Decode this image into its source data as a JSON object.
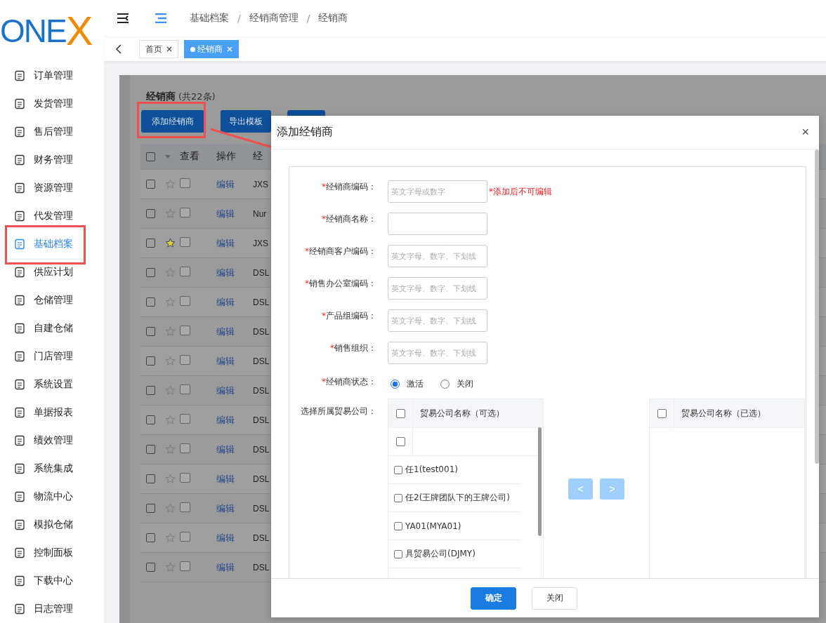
{
  "logo": {
    "text": "ONEX"
  },
  "breadcrumb": {
    "separator": "/",
    "items": [
      "基础档案",
      "经销商管理",
      "经销商"
    ]
  },
  "tabs": [
    {
      "label": "首页",
      "selected": false
    },
    {
      "label": "经销商",
      "selected": true
    }
  ],
  "sidebar": {
    "items": [
      {
        "label": "订单管理",
        "selected": false
      },
      {
        "label": "发货管理",
        "selected": false
      },
      {
        "label": "售后管理",
        "selected": false
      },
      {
        "label": "财务管理",
        "selected": false
      },
      {
        "label": "资源管理",
        "selected": false
      },
      {
        "label": "代发管理",
        "selected": false
      },
      {
        "label": "基础档案",
        "selected": true
      },
      {
        "label": "供应计划",
        "selected": false
      },
      {
        "label": "仓储管理",
        "selected": false
      },
      {
        "label": "自建仓储",
        "selected": false
      },
      {
        "label": "门店管理",
        "selected": false
      },
      {
        "label": "系统设置",
        "selected": false
      },
      {
        "label": "单据报表",
        "selected": false
      },
      {
        "label": "绩效管理",
        "selected": false
      },
      {
        "label": "系统集成",
        "selected": false
      },
      {
        "label": "物流中心",
        "selected": false
      },
      {
        "label": "模拟仓储",
        "selected": false
      },
      {
        "label": "控制面板",
        "selected": false
      },
      {
        "label": "下载中心",
        "selected": false
      },
      {
        "label": "日志管理",
        "selected": false
      }
    ]
  },
  "page": {
    "title": "经销商",
    "count": "(共22条)",
    "buttons": [
      "添加经销商",
      "导出模板"
    ],
    "table": {
      "all_checked": false,
      "columns": [
        "查看",
        "操作",
        "经"
      ],
      "rows": [
        {
          "checked": false,
          "starred": false,
          "action": "编辑",
          "code": "JXS"
        },
        {
          "checked": false,
          "starred": false,
          "action": "编辑",
          "code": "Nur"
        },
        {
          "checked": false,
          "starred": true,
          "action": "编辑",
          "code": "JXS"
        },
        {
          "checked": false,
          "starred": false,
          "action": "编辑",
          "code": "DSL"
        },
        {
          "checked": false,
          "starred": false,
          "action": "编辑",
          "code": "DSL"
        },
        {
          "checked": false,
          "starred": false,
          "action": "编辑",
          "code": "DSL"
        },
        {
          "checked": false,
          "starred": false,
          "action": "编辑",
          "code": "DSL"
        },
        {
          "checked": false,
          "starred": false,
          "action": "编辑",
          "code": "DSL"
        },
        {
          "checked": false,
          "starred": false,
          "action": "编辑",
          "code": "DSL"
        },
        {
          "checked": false,
          "starred": false,
          "action": "编辑",
          "code": "DSL"
        },
        {
          "checked": false,
          "starred": false,
          "action": "编辑",
          "code": "DSL"
        },
        {
          "checked": false,
          "starred": false,
          "action": "编辑",
          "code": "DSL"
        },
        {
          "checked": false,
          "starred": false,
          "action": "编辑",
          "code": "DSL"
        },
        {
          "checked": false,
          "starred": false,
          "action": "编辑",
          "code": "DSL"
        }
      ]
    }
  },
  "dialog": {
    "title": "添加经销商",
    "close": "×",
    "fields": [
      {
        "kind": "text",
        "label": "经销商编码：",
        "required_mark": "*",
        "placeholder": "英文字母或数字",
        "note": "*添加后不可编辑"
      },
      {
        "kind": "text",
        "label": "经销商名称：",
        "required_mark": "*"
      },
      {
        "kind": "text",
        "label": "经销商客户编码：",
        "required_mark": "*",
        "placeholder": "英文字母、数字、下划线"
      },
      {
        "kind": "text",
        "label": "销售办公室编码：",
        "required_mark": "*",
        "placeholder": "英文字母、数字、下划线"
      },
      {
        "kind": "text",
        "label": "产品组编码：",
        "required_mark": "*",
        "placeholder": "英文字母、数字、下划线"
      },
      {
        "kind": "text",
        "label": "销售组织：",
        "required_mark": "*",
        "placeholder": "英文字母、数字、下划线"
      },
      {
        "kind": "radio",
        "label": "经销商状态：",
        "required_mark": "*",
        "options": [
          {
            "label": "激活",
            "selected": true
          },
          {
            "label": "关闭",
            "selected": false
          }
        ]
      },
      {
        "kind": "transfer",
        "label": "选择所属贸易公司：",
        "available": {
          "header": "贸易公司名称（可选）",
          "all_checked": false,
          "items": [
            {
              "checked": false
            },
            {
              "label": "任1(test001)",
              "checked": false
            },
            {
              "label": "任2(王牌团队下的王牌公司)",
              "checked": false
            },
            {
              "label": "YA01(MYA01)",
              "checked": false
            },
            {
              "label": "具贸易公司(DJMY)",
              "checked": false
            }
          ]
        },
        "moves": [
          "<",
          ">"
        ],
        "chosen": {
          "header": "贸易公司名称（已选）",
          "all_checked": false
        }
      }
    ],
    "buttons": [
      {
        "label": "确定",
        "primary": true
      },
      {
        "label": "关闭",
        "primary": false
      }
    ]
  }
}
